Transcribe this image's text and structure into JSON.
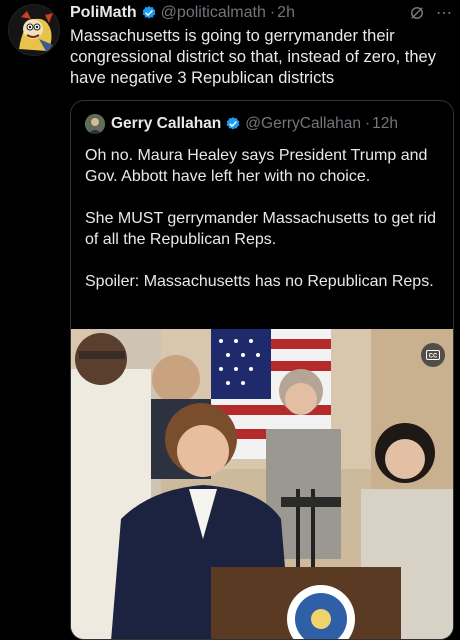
{
  "author": {
    "name": "PoliMath",
    "handle": "@politicalmath",
    "time": "2h"
  },
  "tweet_text": "Massachusetts is going to gerrymander their congressional district so that, instead of zero, they have negative 3  Republican districts",
  "quoted": {
    "name": "Gerry Callahan",
    "handle": "@GerryCallahan",
    "time": "12h",
    "text": "Oh no. Maura Healey says President Trump and Gov. Abbott have left her with no choice.\n\nShe MUST gerrymander Massachusetts to get rid of all the Republican Reps.\n\nSpoiler: Massachusetts has no Republican Reps."
  },
  "media": {
    "badge_icon": "cc-icon"
  },
  "colors": {
    "background": "#000000",
    "text": "#e7e9ea",
    "muted": "#71767b",
    "verified": "#1d9bf0",
    "border": "#2f3336"
  }
}
